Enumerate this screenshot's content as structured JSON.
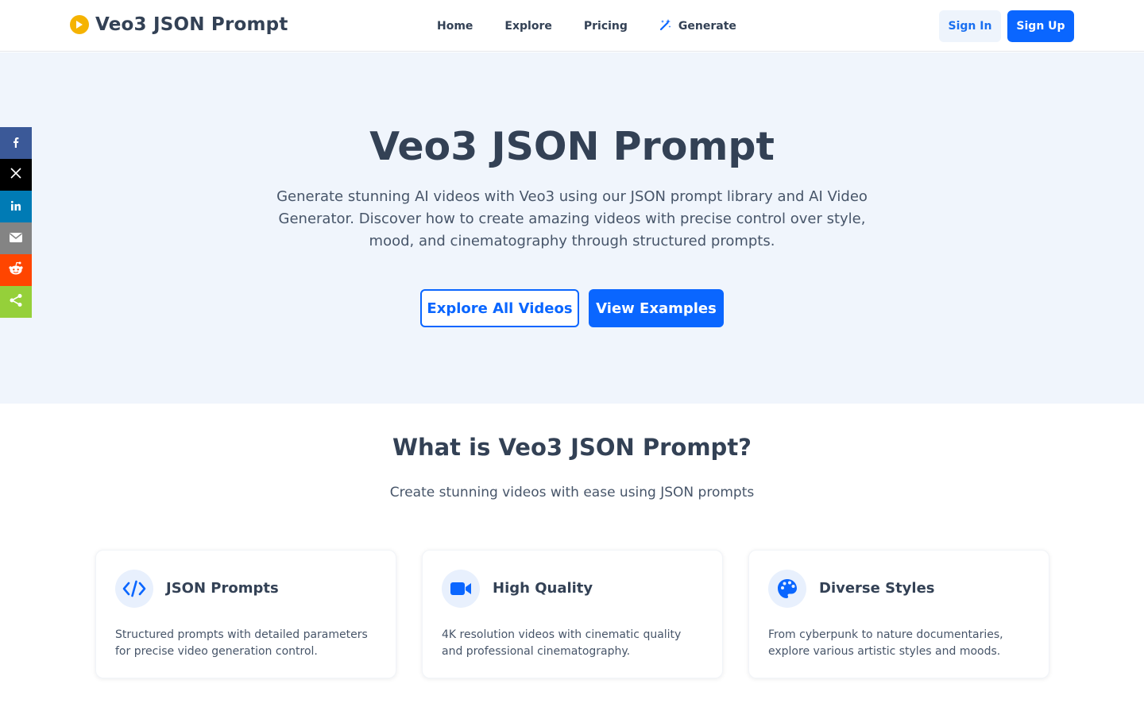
{
  "header": {
    "brand_title": "Veo3 JSON Prompt",
    "brand_icon": "play-circle-icon",
    "nav": {
      "home": "Home",
      "explore": "Explore",
      "pricing": "Pricing",
      "generate": "Generate"
    },
    "sign_in": "Sign In",
    "sign_up": "Sign Up"
  },
  "hero": {
    "title": "Veo3 JSON Prompt",
    "description": "Generate stunning AI videos with Veo3 using our JSON prompt library and AI Video Generator. Discover how to create amazing videos with precise control over style, mood, and cinematography through structured prompts.",
    "explore_button": "Explore All Videos",
    "examples_button": "View Examples"
  },
  "share_bar": {
    "items": [
      "facebook-icon",
      "x-icon",
      "linkedin-icon",
      "email-icon",
      "reddit-icon",
      "share-icon"
    ],
    "colors": {
      "facebook": "#3b5998",
      "x": "#000000",
      "linkedin": "#007bb5",
      "email": "#848484",
      "reddit": "#ff4500",
      "share": "#95d03a"
    }
  },
  "about": {
    "title": "What is Veo3 JSON Prompt?",
    "subtitle": "Create stunning videos with ease using JSON prompts",
    "features": [
      {
        "icon": "code-icon",
        "title": "JSON Prompts",
        "description": "Structured prompts with detailed parameters for precise video generation control."
      },
      {
        "icon": "video-camera-icon",
        "title": "High Quality",
        "description": "4K resolution videos with cinematic quality and professional cinematography."
      },
      {
        "icon": "palette-icon",
        "title": "Diverse Styles",
        "description": "From cyberpunk to nature documentaries, explore various artistic styles and moods."
      }
    ]
  },
  "colors": {
    "primary": "#0a66ff",
    "hero_background": "#f0f5fc",
    "brand_accent": "#f5b301",
    "text_dark": "#334155"
  }
}
